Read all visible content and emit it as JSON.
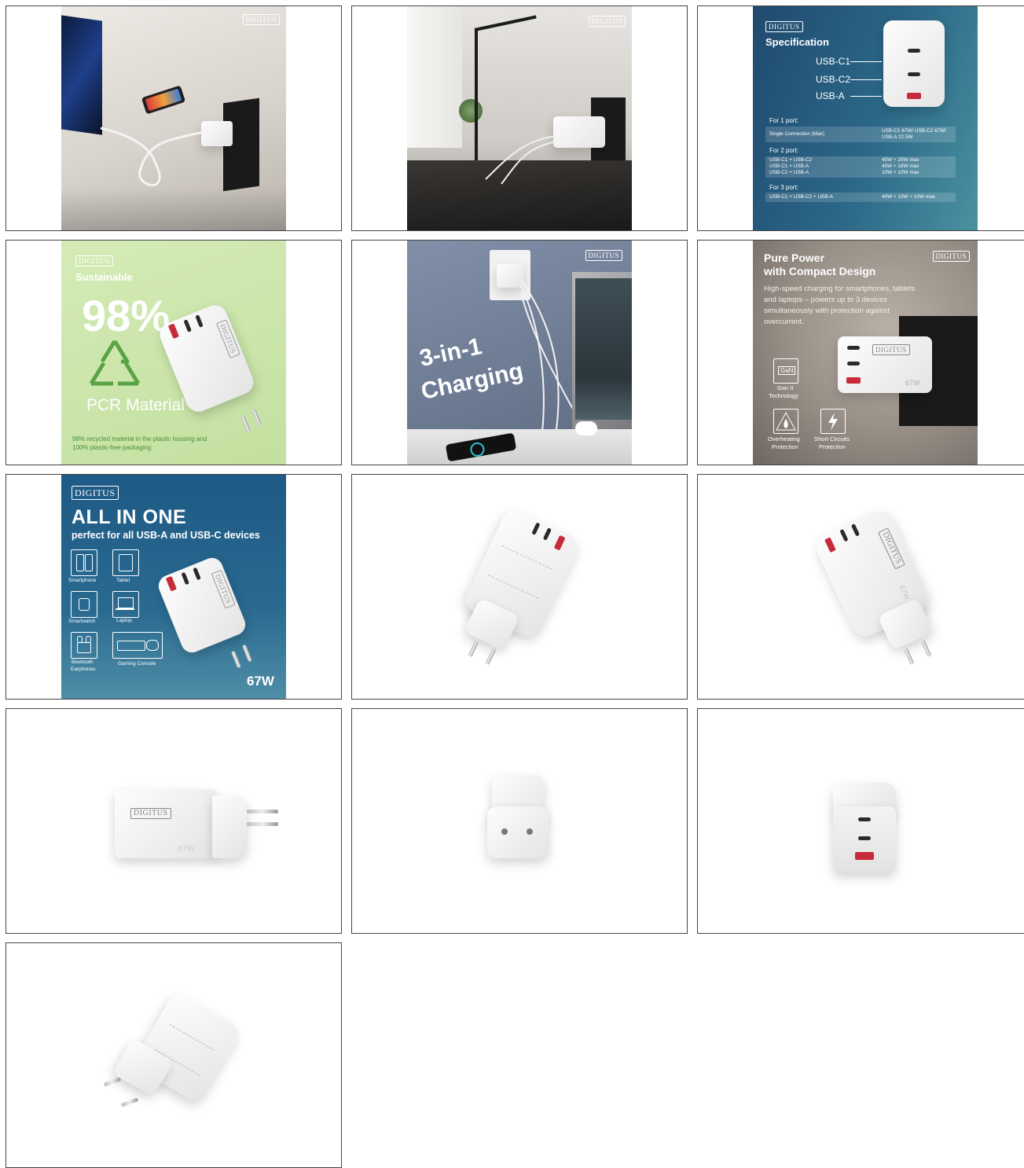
{
  "brand": "DIGITUS",
  "cells": [
    {
      "id": "photo-desk-laptop",
      "logo": "DIGITUS"
    },
    {
      "id": "photo-desk-lamp",
      "logo": "DIGITUS"
    },
    {
      "id": "spec",
      "logo": "DIGITUS",
      "title": "Specification",
      "port_labels": [
        "USB-C1",
        "USB-C2",
        "USB-A"
      ],
      "sections": [
        {
          "heading": "For 1 port:",
          "rows": [
            {
              "left": "Single Connection (Max)",
              "right": "USB-C1 67W/ USB-C2 67W/ USB-A 22.5W"
            }
          ]
        },
        {
          "heading": "For 2 port:",
          "rows": [
            {
              "left": "USB-C1 + USB-C2",
              "right": "45W + 20W max"
            },
            {
              "left": "USB-C1 + USB-A",
              "right": "45W + 18W max"
            },
            {
              "left": "USB-C2 + USB-A",
              "right": "10W + 10W max"
            }
          ]
        },
        {
          "heading": "For 3 port:",
          "rows": [
            {
              "left": "USB-C1 + USB-C2 + USB-A",
              "right": "40W + 10W + 10W max"
            }
          ]
        }
      ]
    },
    {
      "id": "sustainable",
      "logo": "DIGITUS",
      "title": "Sustainable",
      "percent": "98%",
      "material": "PCR Material*",
      "footnote_1": "98% recycled material in the plastic housing  and",
      "footnote_2": "100% plastic-free packaging"
    },
    {
      "id": "three-in-one",
      "logo": "DIGITUS",
      "line1": "3-in-1",
      "line2": "Charging"
    },
    {
      "id": "pure-power",
      "logo": "DIGITUS",
      "title_1": "Pure Power",
      "title_2": "with Compact Design",
      "body_1": "High-speed charging for smartphones, tablets",
      "body_2": "and laptops – powers up to 3 devices",
      "body_3": "simultaneously with protection against",
      "body_4": "overcurrent.",
      "features": [
        {
          "icon": "gan-chip-icon",
          "badge": "GaN",
          "label_1": "Gan II",
          "label_2": "Technology"
        },
        {
          "icon": "flame-icon",
          "label_1": "Overheating",
          "label_2": "Protection"
        },
        {
          "icon": "lightning-icon",
          "label_1": "Short Circuits",
          "label_2": "Protection"
        }
      ],
      "wattage": "67W"
    },
    {
      "id": "all-in-one",
      "logo": "DIGITUS",
      "title": "ALL IN ONE",
      "subtitle": "perfect for all USB-A and USB-C devices",
      "devices": [
        {
          "icon": "smartphone-icon",
          "label": "Smartphone"
        },
        {
          "icon": "tablet-icon",
          "label": "Tablet"
        },
        {
          "icon": "smartwatch-icon",
          "label": "Smartwatch"
        },
        {
          "icon": "laptop-icon",
          "label": "Laptop"
        },
        {
          "icon": "earphones-icon",
          "label_1": "Bluetooth",
          "label_2": "Earphones"
        },
        {
          "icon": "gaming-console-icon",
          "label": "Gaming Console"
        }
      ],
      "wattage": "67W"
    },
    {
      "id": "product-angle-left"
    },
    {
      "id": "product-angle-right",
      "logo": "DIGITUS",
      "wattage": "67W"
    },
    {
      "id": "product-side",
      "logo": "DIGITUS",
      "wattage": "67W"
    },
    {
      "id": "product-back"
    },
    {
      "id": "product-front"
    },
    {
      "id": "product-bottom"
    }
  ],
  "colors": {
    "spec_bg_left": "#1f4a6e",
    "spec_bg_right": "#4a92a0",
    "sustain_bg": "#c9e4a8",
    "recycle_green": "#5aa344",
    "charging_bg": "#6f7d96",
    "allinone_bg": "#1d5a86",
    "usb_a_red": "#c72b3a"
  }
}
